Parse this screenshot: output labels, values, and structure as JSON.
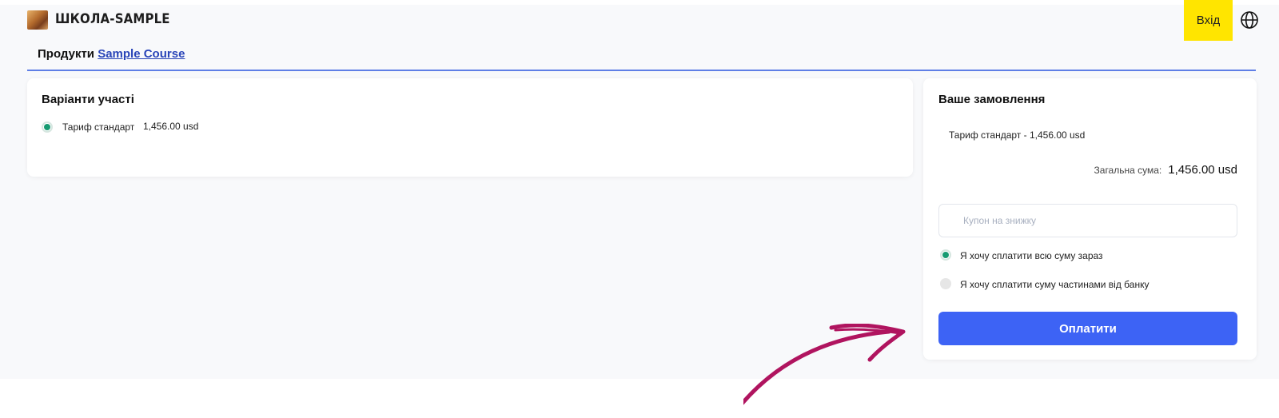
{
  "header": {
    "school_name": "ШКОЛА-SAMPLE",
    "login_label": "Вхід"
  },
  "breadcrumb": {
    "prefix": "Продукти",
    "link": "Sample Course"
  },
  "options": {
    "title": "Варіанти участі",
    "tariff_name": "Тариф стандарт",
    "tariff_price": "1,456.00 usd"
  },
  "order": {
    "title": "Ваше замовлення",
    "line_item": "Тариф стандарт - 1,456.00 usd",
    "total_label": "Загальна сума:",
    "total_value": "1,456.00 usd",
    "coupon_placeholder": "Купон на знижку",
    "pay_full_label": "Я хочу сплатити всю суму зараз",
    "pay_installments_label": "Я хочу сплатити суму частинами від банку",
    "pay_button": "Оплатити"
  },
  "colors": {
    "login_bg": "#ffe500",
    "pay_button": "#3d63f5",
    "radio_selected": "#179b72",
    "rule": "#5f7fe6",
    "arrow": "#b0145f"
  },
  "icons": {
    "language": "globe-icon",
    "annotation": "arrow-icon"
  }
}
